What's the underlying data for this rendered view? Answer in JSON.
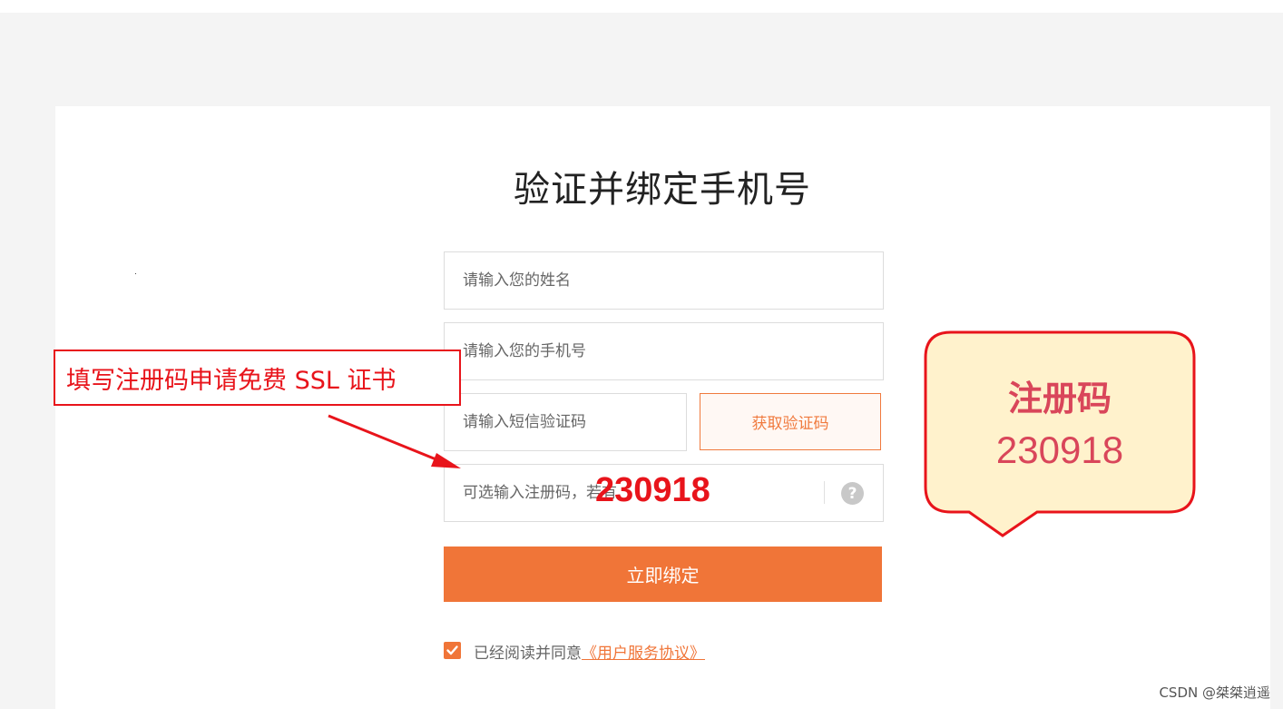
{
  "page": {
    "title": "验证并绑定手机号"
  },
  "form": {
    "name_placeholder": "请输入您的姓名",
    "phone_placeholder": "请输入您的手机号",
    "sms_placeholder": "请输入短信验证码",
    "get_code_label": "获取验证码",
    "reg_code_placeholder": "可选输入注册码，若有",
    "help_icon": "?",
    "submit_label": "立即绑定",
    "agree_text": "已经阅读并同意",
    "agree_link": "《用户服务协议》"
  },
  "annotations": {
    "overlay_code": "230918",
    "instruction": "填写注册码申请免费 SSL 证书",
    "callout_title": "注册码",
    "callout_code": "230918"
  },
  "watermark": "CSDN @桀桀逍遥",
  "colors": {
    "accent": "#f07538",
    "annotation_red": "#e8141b",
    "callout_fill": "#fff2cc",
    "callout_text": "#d9465a"
  }
}
